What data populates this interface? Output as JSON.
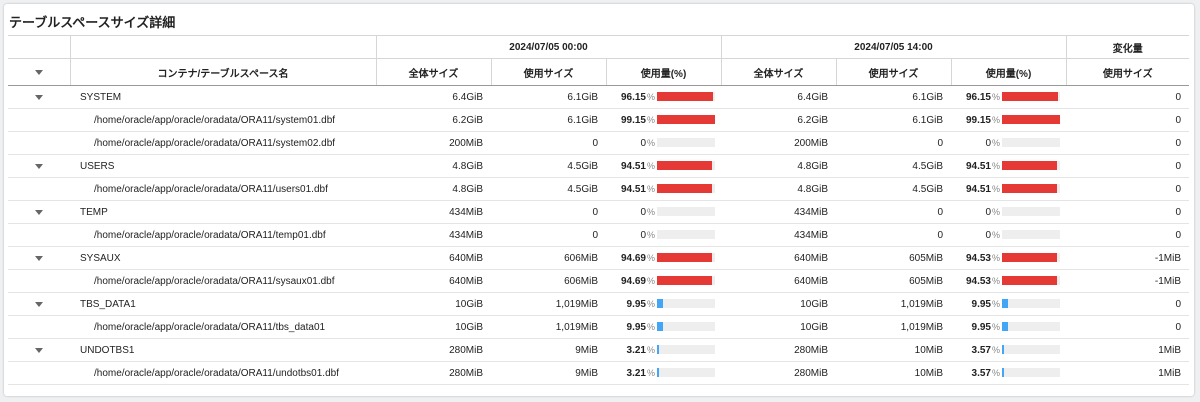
{
  "title": "テーブルスペースサイズ詳細",
  "header": {
    "period1": "2024/07/05 00:00",
    "period2": "2024/07/05 14:00",
    "change_group": "変化量",
    "name_col": "コンテナ/テーブルスペース名",
    "total_col": "全体サイズ",
    "used_col": "使用サイズ",
    "pct_col": "使用量(%)",
    "change_col": "使用サイズ",
    "pct_suffix": "%"
  },
  "colors": {
    "high": "#e53935",
    "low": "#42a5f5"
  },
  "rows": [
    {
      "level": 0,
      "name": "SYSTEM",
      "t1": "6.4GiB",
      "u1": "6.1GiB",
      "p1": "96.15",
      "t2": "6.4GiB",
      "u2": "6.1GiB",
      "p2": "96.15",
      "chg": "0"
    },
    {
      "level": 1,
      "name": "/home/oracle/app/oracle/oradata/ORA11/system01.dbf",
      "t1": "6.2GiB",
      "u1": "6.1GiB",
      "p1": "99.15",
      "t2": "6.2GiB",
      "u2": "6.1GiB",
      "p2": "99.15",
      "chg": "0"
    },
    {
      "level": 1,
      "name": "/home/oracle/app/oracle/oradata/ORA11/system02.dbf",
      "t1": "200MiB",
      "u1": "0",
      "p1": "0",
      "t2": "200MiB",
      "u2": "0",
      "p2": "0",
      "chg": "0"
    },
    {
      "level": 0,
      "name": "USERS",
      "t1": "4.8GiB",
      "u1": "4.5GiB",
      "p1": "94.51",
      "t2": "4.8GiB",
      "u2": "4.5GiB",
      "p2": "94.51",
      "chg": "0"
    },
    {
      "level": 1,
      "name": "/home/oracle/app/oracle/oradata/ORA11/users01.dbf",
      "t1": "4.8GiB",
      "u1": "4.5GiB",
      "p1": "94.51",
      "t2": "4.8GiB",
      "u2": "4.5GiB",
      "p2": "94.51",
      "chg": "0"
    },
    {
      "level": 0,
      "name": "TEMP",
      "t1": "434MiB",
      "u1": "0",
      "p1": "0",
      "t2": "434MiB",
      "u2": "0",
      "p2": "0",
      "chg": "0"
    },
    {
      "level": 1,
      "name": "/home/oracle/app/oracle/oradata/ORA11/temp01.dbf",
      "t1": "434MiB",
      "u1": "0",
      "p1": "0",
      "t2": "434MiB",
      "u2": "0",
      "p2": "0",
      "chg": "0"
    },
    {
      "level": 0,
      "name": "SYSAUX",
      "t1": "640MiB",
      "u1": "606MiB",
      "p1": "94.69",
      "t2": "640MiB",
      "u2": "605MiB",
      "p2": "94.53",
      "chg": "-1MiB"
    },
    {
      "level": 1,
      "name": "/home/oracle/app/oracle/oradata/ORA11/sysaux01.dbf",
      "t1": "640MiB",
      "u1": "606MiB",
      "p1": "94.69",
      "t2": "640MiB",
      "u2": "605MiB",
      "p2": "94.53",
      "chg": "-1MiB"
    },
    {
      "level": 0,
      "name": "TBS_DATA1",
      "t1": "10GiB",
      "u1": "1,019MiB",
      "p1": "9.95",
      "t2": "10GiB",
      "u2": "1,019MiB",
      "p2": "9.95",
      "chg": "0"
    },
    {
      "level": 1,
      "name": "/home/oracle/app/oracle/oradata/ORA11/tbs_data01",
      "t1": "10GiB",
      "u1": "1,019MiB",
      "p1": "9.95",
      "t2": "10GiB",
      "u2": "1,019MiB",
      "p2": "9.95",
      "chg": "0"
    },
    {
      "level": 0,
      "name": "UNDOTBS1",
      "t1": "280MiB",
      "u1": "9MiB",
      "p1": "3.21",
      "t2": "280MiB",
      "u2": "10MiB",
      "p2": "3.57",
      "chg": "1MiB"
    },
    {
      "level": 1,
      "name": "/home/oracle/app/oracle/oradata/ORA11/undotbs01.dbf",
      "t1": "280MiB",
      "u1": "9MiB",
      "p1": "3.21",
      "t2": "280MiB",
      "u2": "10MiB",
      "p2": "3.57",
      "chg": "1MiB"
    }
  ]
}
